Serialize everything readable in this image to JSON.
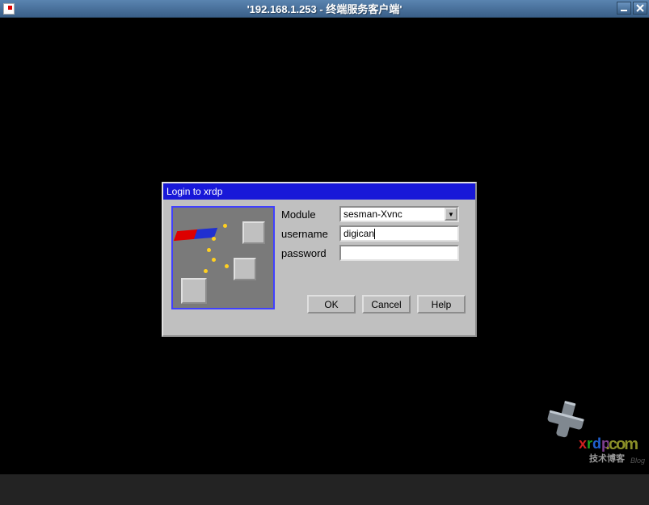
{
  "window": {
    "title": "'192.168.1.253 - 终端服务客户端'"
  },
  "dialog": {
    "title": "Login to xrdp",
    "module_label": "Module",
    "module_value": "sesman-Xvnc",
    "username_label": "username",
    "username_value": "digican",
    "password_label": "password",
    "password_value": "",
    "ok": "OK",
    "cancel": "Cancel",
    "help": "Help"
  },
  "watermark": {
    "brand": "xrdp",
    "site_cn": "技术博客",
    "blog": "Blog"
  }
}
